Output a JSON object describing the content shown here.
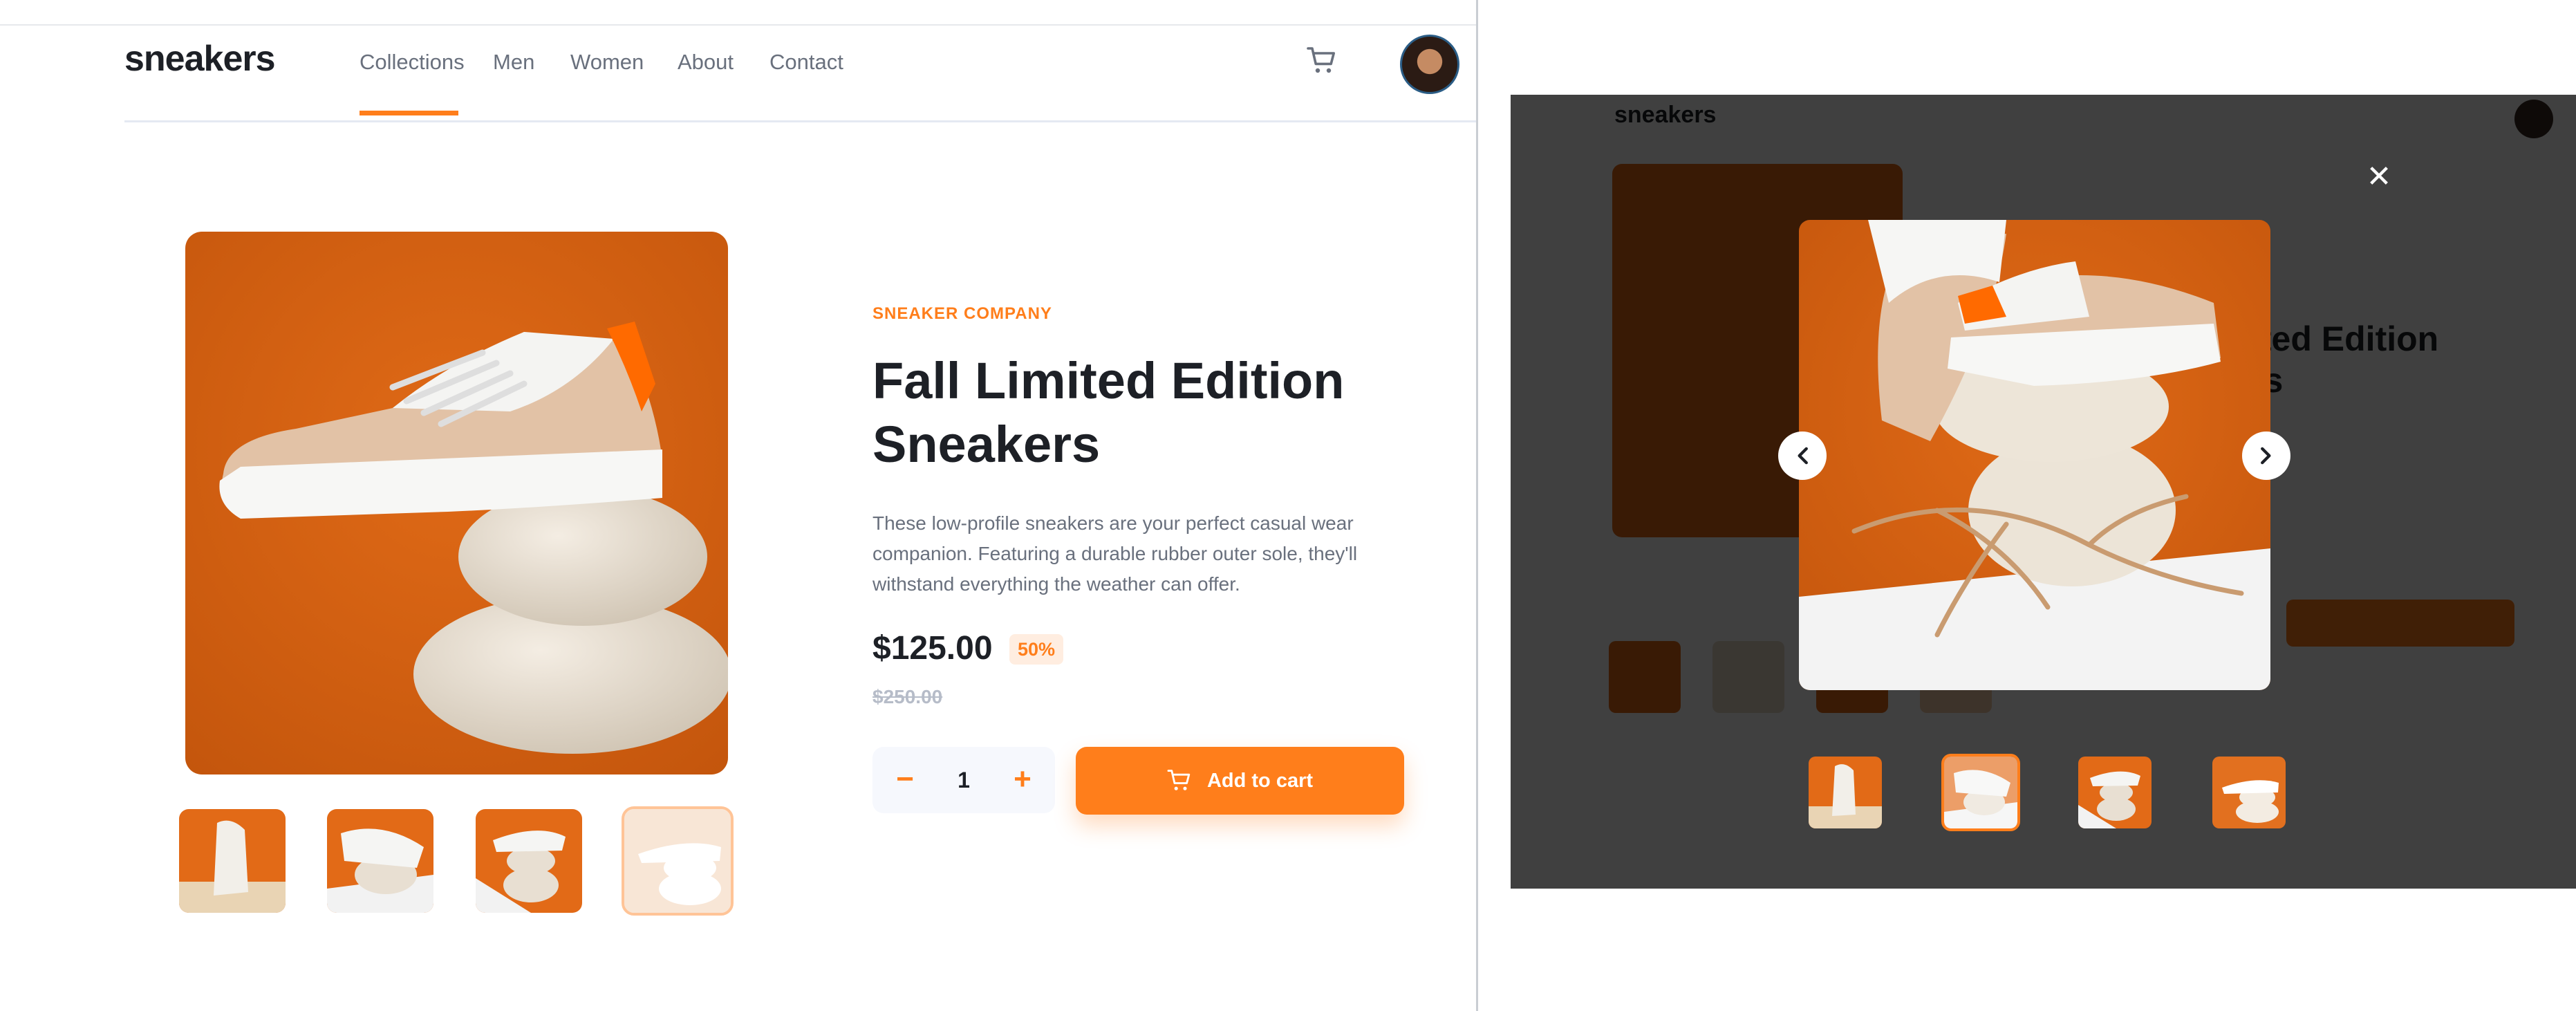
{
  "brand": {
    "logo": "sneakers",
    "accent": "#ff7e1b"
  },
  "nav": {
    "items": [
      "Collections",
      "Men",
      "Women",
      "About",
      "Contact"
    ],
    "active": "Collections"
  },
  "header": {
    "cart_icon": "cart-icon",
    "avatar": "user-avatar"
  },
  "gallery": {
    "main_image": "product-image-1",
    "thumbnails": [
      "product-thumbnail-1",
      "product-thumbnail-2",
      "product-thumbnail-3",
      "product-thumbnail-4"
    ],
    "selected_thumbnail": 4
  },
  "product": {
    "company": "SNEAKER COMPANY",
    "title_line1": "Fall Limited Edition",
    "title_line2": "Sneakers",
    "description": "These low-profile sneakers are your perfect casual wear companion. Featuring a durable rubber outer sole, they'll withstand everything the weather can offer.",
    "price": "$125.00",
    "discount": "50%",
    "original_price": "$250.00"
  },
  "cart_controls": {
    "minus": "−",
    "quantity": "1",
    "plus": "+",
    "add_label": "Add to cart"
  },
  "lightbox": {
    "close": "✕",
    "image": "product-image-2",
    "prev_icon": "chevron-left-icon",
    "next_icon": "chevron-right-icon",
    "thumbnails": [
      "product-thumbnail-1",
      "product-thumbnail-2",
      "product-thumbnail-3",
      "product-thumbnail-4"
    ],
    "selected_thumbnail": 2
  },
  "colors": {
    "orange": "#ff7e1b",
    "pale_orange": "#ffede0",
    "dark": "#1d2026",
    "grey": "#69707d",
    "light_grey": "#b6bcc8",
    "light_bg": "#f6f8fd"
  }
}
